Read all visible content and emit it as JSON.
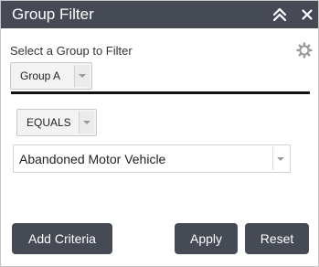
{
  "header": {
    "title": "Group Filter",
    "collapse_icon": "double-chevron-up-icon",
    "close_icon": "close-icon"
  },
  "group_section": {
    "prompt": "Select a Group to Filter",
    "settings_icon": "gear-icon",
    "selected_group": "Group A"
  },
  "criteria": {
    "operator": "EQUALS",
    "value": "Abandoned Motor Vehicle"
  },
  "buttons": {
    "add_criteria": "Add Criteria",
    "apply": "Apply",
    "reset": "Reset"
  },
  "colors": {
    "header_bg": "#454a55",
    "button_bg": "#454a55",
    "divider": "#111111"
  }
}
